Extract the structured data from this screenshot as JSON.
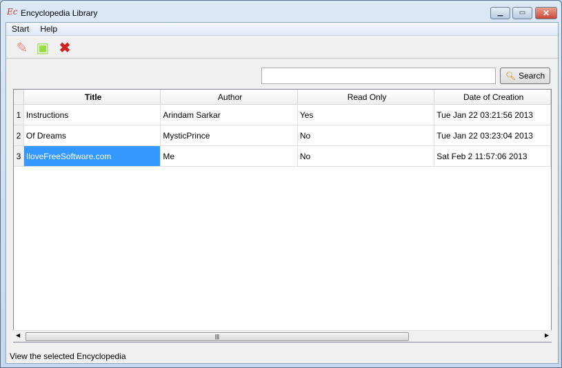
{
  "window": {
    "title": "Encyclopedia Library",
    "app_icon": "encyclopedia-logo"
  },
  "menu": [
    "Start",
    "Help"
  ],
  "toolbar": {
    "icons": [
      "edit-icon",
      "open-icon",
      "delete-icon"
    ]
  },
  "search": {
    "value": "",
    "button_label": "Search"
  },
  "table": {
    "columns": [
      "Title",
      "Author",
      "Read Only",
      "Date of Creation"
    ],
    "rows": [
      {
        "n": "1",
        "title": "Instructions",
        "author": "Arindam Sarkar",
        "read_only": "Yes",
        "date": "Tue Jan 22 03:21:56 2013"
      },
      {
        "n": "2",
        "title": "Of Dreams",
        "author": "MysticPrince",
        "read_only": "No",
        "date": "Tue Jan 22 03:23:04 2013"
      },
      {
        "n": "3",
        "title": "IloveFreeSoftware.com",
        "author": "Me",
        "read_only": "No",
        "date": "Sat Feb 2 11:57:06 2013"
      }
    ],
    "selected_row": 3
  },
  "status": "View the selected Encyclopedia",
  "colors": {
    "selection": "#3399ff",
    "close": "#c9483a"
  }
}
